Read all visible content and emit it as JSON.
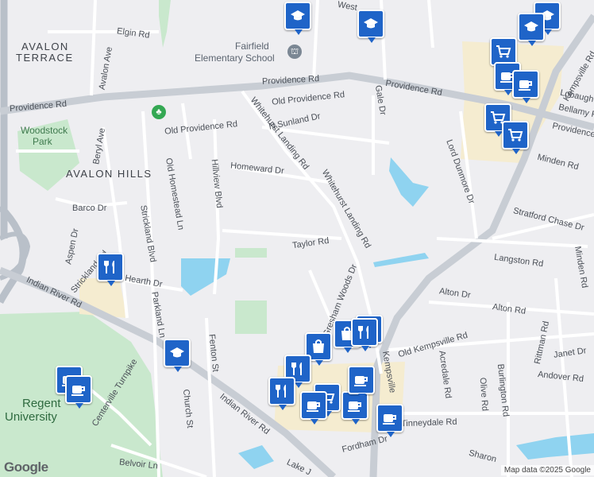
{
  "map": {
    "places": {
      "avalon_terrace_1": "AVALON",
      "avalon_terrace_2": "TERRACE",
      "avalon_hills": "AVALON HILLS",
      "woodstock_park_1": "Woodstock",
      "woodstock_park_2": "Park",
      "regent_1": "Regent",
      "regent_2": "University",
      "fairfield_1": "Fairfield",
      "fairfield_2": "Elementary School"
    },
    "roads": {
      "elgin": "Elgin Rd",
      "avalon_ave": "Avalon Ave",
      "providence_w": "Providence Rd",
      "providence_c": "Providence Rd",
      "providence_e": "Providence Rd",
      "providence_ne": "Providence",
      "old_providence_1": "Old Providence Rd",
      "old_providence_2": "Old Providence Rd",
      "n_sunland": "N Sunland Dr",
      "whitehurst_1": "Whitehurst Landing Rd",
      "whitehurst_2": "Whitehurst Landing Rd",
      "gale": "Gale Dr",
      "beryl": "Beryl Ave",
      "homeward": "Homeward Dr",
      "old_homestead": "Old Homestead Ln",
      "hillview": "Hillview Blvd",
      "strickland_blvd": "Strickland Blvd",
      "barco": "Barco Dr",
      "aspen": "Aspen Dr",
      "strickland_rd": "Strickland Rd",
      "hearth": "Hearth Dr",
      "taylor": "Taylor Rd",
      "lord_dunmore": "Lord Dunmore Dr",
      "minden_rd": "Minden Rd",
      "stratford": "Stratford Chase Dr",
      "langston": "Langston Rd",
      "minden_dr": "Minden Rd",
      "kempsville_top": "Kempsville Rd",
      "lobaugh": "Lobaugh",
      "bellamy": "Bellamy P",
      "indian_river_w": "Indian River Rd",
      "indian_river_c": "Indian River Rd",
      "parkland": "Parkland Ln",
      "fenton": "Fenton St",
      "centerville": "Centerville Turnpike",
      "church": "Church St",
      "gresham": "Gresham Woods Dr",
      "kempsville_bottom": "Kempsville",
      "alton_dr": "Alton Dr",
      "alton_rd": "Alton Rd",
      "rittman": "Rittman Rd",
      "old_kempsville": "Old Kempsville Rd",
      "janet": "Janet Dr",
      "andover": "Andover Rd",
      "acredale": "Acredale Rd",
      "olive": "Olive Rd",
      "burlington": "Burlington Rd",
      "tinneydale": "Tinneydale Rd",
      "fordham": "Fordham Dr",
      "sharon": "Sharon",
      "belvoir": "Belvoir Ln",
      "lake": "Lake J",
      "west": "West"
    },
    "pins": [
      {
        "type": "school",
        "name": "school-pin"
      },
      {
        "type": "school",
        "name": "school-pin"
      },
      {
        "type": "school",
        "name": "school-pin"
      },
      {
        "type": "school",
        "name": "school-pin"
      },
      {
        "type": "shopping-cart",
        "name": "grocery-pin"
      },
      {
        "type": "coffee",
        "name": "cafe-pin"
      },
      {
        "type": "coffee",
        "name": "cafe-pin"
      },
      {
        "type": "shopping-cart",
        "name": "grocery-pin"
      },
      {
        "type": "shopping-cart",
        "name": "grocery-pin"
      },
      {
        "type": "restaurant",
        "name": "restaurant-pin"
      },
      {
        "type": "school",
        "name": "school-pin"
      },
      {
        "type": "shopping-bag",
        "name": "store-pin"
      },
      {
        "type": "shopping-bag",
        "name": "store-pin"
      },
      {
        "type": "restaurant",
        "name": "restaurant-pin"
      },
      {
        "type": "restaurant",
        "name": "restaurant-pin"
      },
      {
        "type": "coffee",
        "name": "cafe-pin"
      },
      {
        "type": "coffee",
        "name": "cafe-pin"
      },
      {
        "type": "restaurant",
        "name": "restaurant-pin"
      },
      {
        "type": "restaurant",
        "name": "restaurant-pin"
      },
      {
        "type": "shopping-cart",
        "name": "grocery-pin"
      },
      {
        "type": "coffee",
        "name": "cafe-pin"
      },
      {
        "type": "coffee",
        "name": "cafe-pin"
      },
      {
        "type": "coffee",
        "name": "cafe-pin"
      },
      {
        "type": "coffee",
        "name": "cafe-pin"
      }
    ],
    "logo": "Google",
    "attribution": "Map data ©2025 Google",
    "colors": {
      "pin": "#1f64c8",
      "water": "#8fd3f0",
      "park": "#c9e8cd",
      "commercial": "#f5ecd0",
      "major_road": "#c8cdd4"
    }
  }
}
